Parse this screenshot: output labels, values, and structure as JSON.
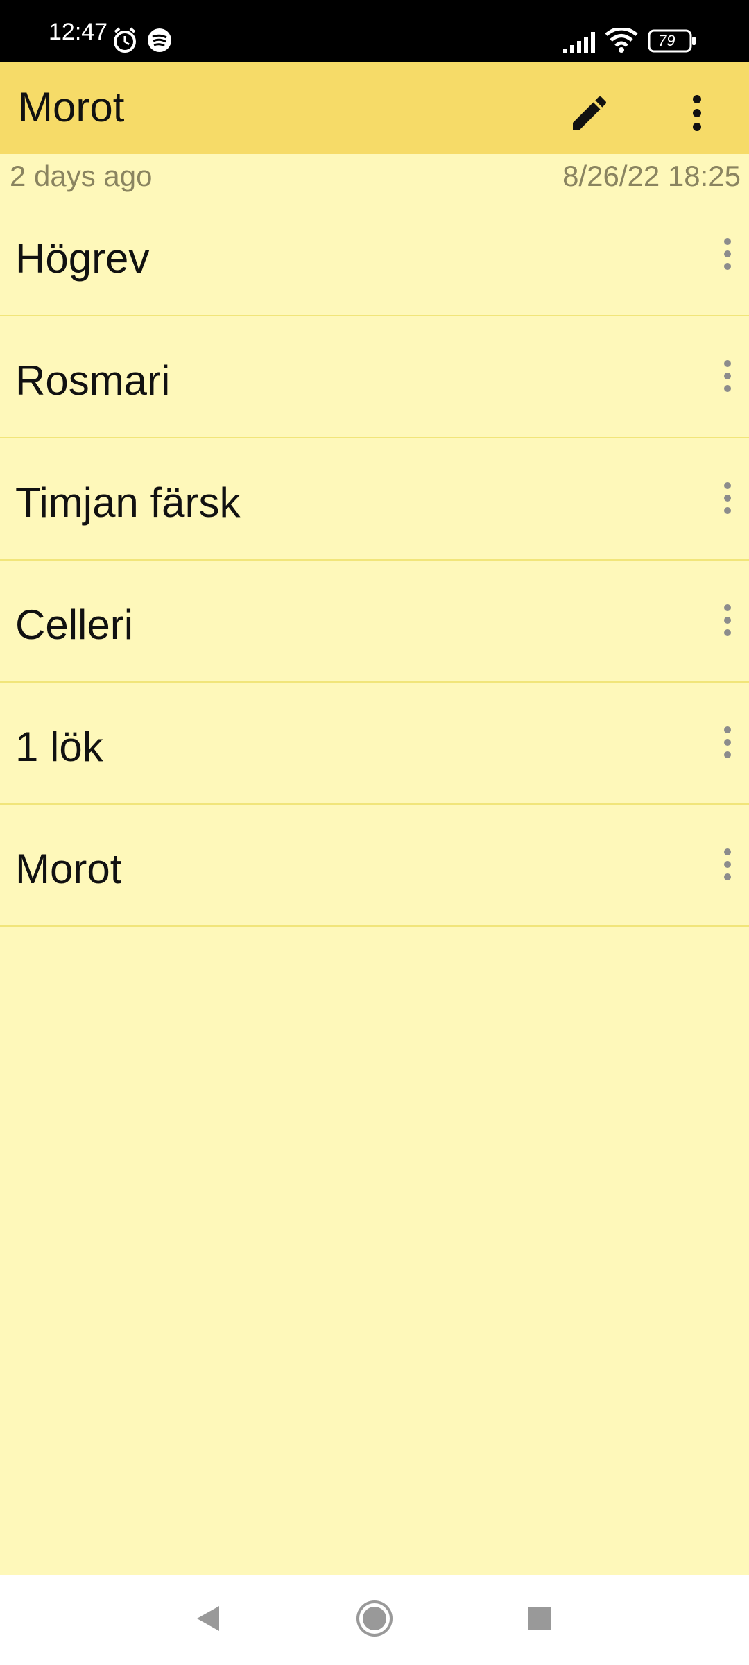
{
  "status_bar": {
    "time": "12:47",
    "battery": "79",
    "icons": [
      "alarm-icon",
      "spotify-icon",
      "signal-icon",
      "wifi-icon",
      "battery-icon"
    ]
  },
  "app_bar": {
    "title": "Morot",
    "edit_icon": "pencil-icon",
    "more_icon": "more-vert-icon"
  },
  "meta": {
    "relative_time": "2 days ago",
    "timestamp": "8/26/22 18:25"
  },
  "items": [
    {
      "label": "Högrev"
    },
    {
      "label": "Rosmari"
    },
    {
      "label": "Timjan färsk"
    },
    {
      "label": "Celleri"
    },
    {
      "label": "1 lök"
    },
    {
      "label": "Morot"
    }
  ],
  "colors": {
    "app_bar": "#F6DB68",
    "background": "#FEF8BA",
    "divider": "#F1E57A",
    "meta_text": "#8A8460"
  },
  "nav": {
    "back_icon": "back-triangle-icon",
    "home_icon": "home-circle-icon",
    "recents_icon": "recents-square-icon"
  }
}
